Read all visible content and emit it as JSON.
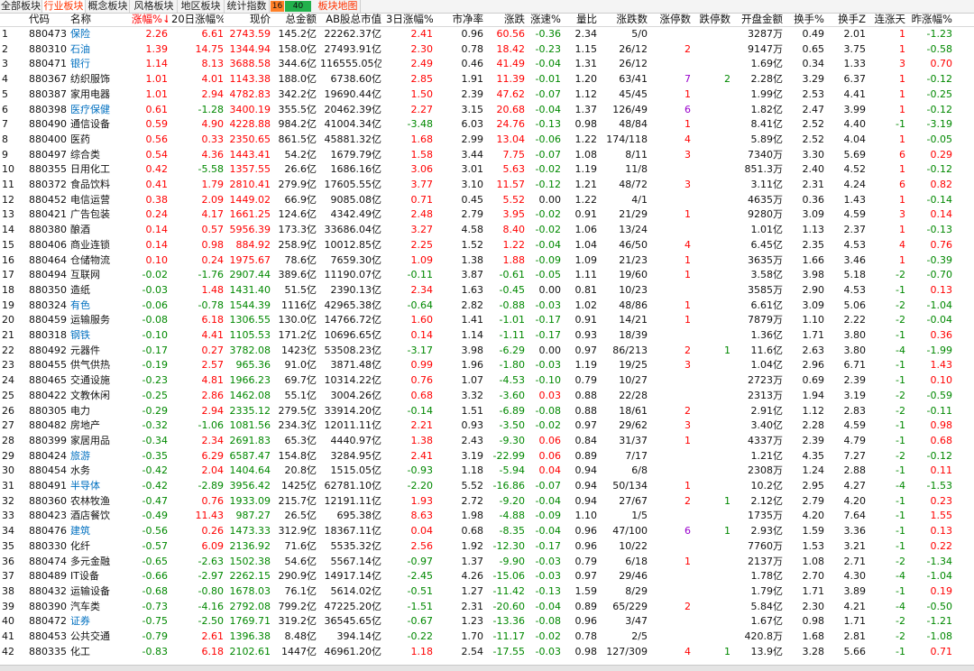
{
  "tabs": [
    {
      "label": "全部板块",
      "active": false
    },
    {
      "label": "行业板块",
      "active": true
    },
    {
      "label": "概念板块",
      "active": false
    },
    {
      "label": "风格板块",
      "active": false
    },
    {
      "label": "地区板块",
      "active": false
    },
    {
      "label": "统计指数",
      "active": false
    },
    {
      "label": "板块地图",
      "active": false
    }
  ],
  "counters": {
    "a": "16",
    "b": "40"
  },
  "colors": {
    "up": "#ff0000",
    "down": "#008800",
    "link": "#0070c0",
    "active_tab": "#ff3300",
    "counter_a": "#ff7f27",
    "counter_b": "#22b14c"
  },
  "headers": [
    "",
    "代码",
    "名称",
    "涨幅%↓",
    "20日涨幅%",
    "现价",
    "总金额",
    "AB股总市值",
    "3日涨幅%",
    "市净率",
    "涨跌",
    "涨速%",
    "量比",
    "涨跌数",
    "涨停数",
    "跌停数",
    "开盘金额",
    "换手%",
    "换手Z",
    "连涨天",
    "昨涨幅%"
  ],
  "rows": [
    [
      "1",
      "880473",
      "保险",
      "2.26",
      "6.61",
      "2743.59",
      "145.2亿",
      "22262.37亿",
      "2.41",
      "0.96",
      "60.56",
      "-0.36",
      "2.34",
      "5/0",
      "",
      "",
      "3287万",
      "0.49",
      "2.01",
      "1",
      "-1.23"
    ],
    [
      "2",
      "880310",
      "石油",
      "1.39",
      "14.75",
      "1344.94",
      "158.0亿",
      "27493.91亿",
      "2.30",
      "0.78",
      "18.42",
      "-0.23",
      "1.15",
      "26/12",
      "2",
      "",
      "9147万",
      "0.65",
      "3.75",
      "1",
      "-0.58"
    ],
    [
      "3",
      "880471",
      "银行",
      "1.14",
      "8.13",
      "3688.58",
      "344.6亿",
      "116555.05亿",
      "2.49",
      "0.46",
      "41.49",
      "-0.04",
      "1.31",
      "26/12",
      "",
      "",
      "1.69亿",
      "0.34",
      "1.33",
      "3",
      "0.70"
    ],
    [
      "4",
      "880367",
      "纺织服饰",
      "1.01",
      "4.01",
      "1143.38",
      "188.0亿",
      "6738.60亿",
      "2.85",
      "1.91",
      "11.39",
      "-0.01",
      "1.20",
      "63/41",
      "7",
      "2",
      "2.28亿",
      "3.29",
      "6.37",
      "1",
      "-0.12"
    ],
    [
      "5",
      "880387",
      "家用电器",
      "1.01",
      "2.94",
      "4782.83",
      "342.2亿",
      "19690.44亿",
      "1.50",
      "2.39",
      "47.62",
      "-0.07",
      "1.12",
      "45/45",
      "1",
      "",
      "1.99亿",
      "2.53",
      "4.41",
      "1",
      "-0.25"
    ],
    [
      "6",
      "880398",
      "医疗保健",
      "0.61",
      "-1.28",
      "3400.19",
      "355.5亿",
      "20462.39亿",
      "2.27",
      "3.15",
      "20.68",
      "-0.04",
      "1.37",
      "126/49",
      "6",
      "",
      "1.82亿",
      "2.47",
      "3.99",
      "1",
      "-0.12"
    ],
    [
      "7",
      "880490",
      "通信设备",
      "0.59",
      "4.90",
      "4228.88",
      "984.2亿",
      "41004.34亿",
      "-3.48",
      "6.03",
      "24.76",
      "-0.13",
      "0.98",
      "48/84",
      "1",
      "",
      "8.41亿",
      "2.52",
      "4.40",
      "-1",
      "-3.19"
    ],
    [
      "8",
      "880400",
      "医药",
      "0.56",
      "0.33",
      "2350.65",
      "861.5亿",
      "45881.32亿",
      "1.68",
      "2.99",
      "13.04",
      "-0.06",
      "1.22",
      "174/118",
      "4",
      "",
      "5.89亿",
      "2.52",
      "4.04",
      "1",
      "-0.05"
    ],
    [
      "9",
      "880497",
      "综合类",
      "0.54",
      "4.36",
      "1443.41",
      "54.2亿",
      "1679.79亿",
      "1.58",
      "3.44",
      "7.75",
      "-0.07",
      "1.08",
      "8/11",
      "3",
      "",
      "7340万",
      "3.30",
      "5.69",
      "6",
      "0.29"
    ],
    [
      "10",
      "880355",
      "日用化工",
      "0.42",
      "-5.58",
      "1357.55",
      "26.6亿",
      "1686.16亿",
      "3.06",
      "3.01",
      "5.63",
      "-0.02",
      "1.19",
      "11/8",
      "",
      "",
      "851.3万",
      "2.40",
      "4.52",
      "1",
      "-0.12"
    ],
    [
      "11",
      "880372",
      "食品饮料",
      "0.41",
      "1.79",
      "2810.41",
      "279.9亿",
      "17605.55亿",
      "3.77",
      "3.10",
      "11.57",
      "-0.12",
      "1.21",
      "48/72",
      "3",
      "",
      "3.11亿",
      "2.31",
      "4.24",
      "6",
      "0.82"
    ],
    [
      "12",
      "880452",
      "电信运营",
      "0.38",
      "2.09",
      "1449.02",
      "66.9亿",
      "9085.08亿",
      "0.71",
      "0.45",
      "5.52",
      "0.00",
      "1.22",
      "4/1",
      "",
      "",
      "4635万",
      "0.36",
      "1.43",
      "1",
      "-0.14"
    ],
    [
      "13",
      "880421",
      "广告包装",
      "0.24",
      "4.17",
      "1661.25",
      "124.6亿",
      "4342.49亿",
      "2.48",
      "2.79",
      "3.95",
      "-0.02",
      "0.91",
      "21/29",
      "1",
      "",
      "9280万",
      "3.09",
      "4.59",
      "3",
      "0.14"
    ],
    [
      "14",
      "880380",
      "酿酒",
      "0.14",
      "0.57",
      "5956.39",
      "173.3亿",
      "33686.04亿",
      "3.27",
      "4.58",
      "8.40",
      "-0.02",
      "1.06",
      "13/24",
      "",
      "",
      "1.01亿",
      "1.13",
      "2.37",
      "1",
      "-0.13"
    ],
    [
      "15",
      "880406",
      "商业连锁",
      "0.14",
      "0.98",
      "884.92",
      "258.9亿",
      "10012.85亿",
      "2.25",
      "1.52",
      "1.22",
      "-0.04",
      "1.04",
      "46/50",
      "4",
      "",
      "6.45亿",
      "2.35",
      "4.53",
      "4",
      "0.76"
    ],
    [
      "16",
      "880464",
      "仓储物流",
      "0.10",
      "0.24",
      "1975.67",
      "78.6亿",
      "7659.30亿",
      "1.09",
      "1.38",
      "1.88",
      "-0.09",
      "1.09",
      "21/23",
      "1",
      "",
      "3635万",
      "1.66",
      "3.46",
      "1",
      "-0.39"
    ],
    [
      "17",
      "880494",
      "互联网",
      "-0.02",
      "-1.76",
      "2907.44",
      "389.6亿",
      "11190.07亿",
      "-0.11",
      "3.87",
      "-0.61",
      "-0.05",
      "1.11",
      "19/60",
      "1",
      "",
      "3.58亿",
      "3.98",
      "5.18",
      "-2",
      "-0.70"
    ],
    [
      "18",
      "880350",
      "造纸",
      "-0.03",
      "1.48",
      "1431.40",
      "51.5亿",
      "2390.13亿",
      "2.34",
      "1.63",
      "-0.45",
      "0.00",
      "0.81",
      "10/23",
      "",
      "",
      "3585万",
      "2.90",
      "4.53",
      "-1",
      "0.13"
    ],
    [
      "19",
      "880324",
      "有色",
      "-0.06",
      "-0.78",
      "1544.39",
      "1116亿",
      "42965.38亿",
      "-0.64",
      "2.82",
      "-0.88",
      "-0.03",
      "1.02",
      "48/86",
      "1",
      "",
      "6.61亿",
      "3.09",
      "5.06",
      "-2",
      "-1.04"
    ],
    [
      "20",
      "880459",
      "运输服务",
      "-0.08",
      "6.18",
      "1306.55",
      "130.0亿",
      "14766.72亿",
      "1.60",
      "1.41",
      "-1.01",
      "-0.17",
      "0.91",
      "14/21",
      "1",
      "",
      "7879万",
      "1.10",
      "2.22",
      "-2",
      "-0.04"
    ],
    [
      "21",
      "880318",
      "钢铁",
      "-0.10",
      "4.41",
      "1105.53",
      "171.2亿",
      "10696.65亿",
      "0.14",
      "1.14",
      "-1.11",
      "-0.17",
      "0.93",
      "18/39",
      "",
      "",
      "1.36亿",
      "1.71",
      "3.80",
      "-1",
      "0.36"
    ],
    [
      "22",
      "880492",
      "元器件",
      "-0.17",
      "0.27",
      "3782.08",
      "1423亿",
      "53508.23亿",
      "-3.17",
      "3.98",
      "-6.29",
      "0.00",
      "0.97",
      "86/213",
      "2",
      "1",
      "11.6亿",
      "2.63",
      "3.80",
      "-4",
      "-1.99"
    ],
    [
      "23",
      "880455",
      "供气供热",
      "-0.19",
      "2.57",
      "965.36",
      "91.0亿",
      "3871.48亿",
      "0.99",
      "1.96",
      "-1.80",
      "-0.03",
      "1.19",
      "19/25",
      "3",
      "",
      "1.04亿",
      "2.96",
      "6.71",
      "-1",
      "1.43"
    ],
    [
      "24",
      "880465",
      "交通设施",
      "-0.23",
      "4.81",
      "1966.23",
      "69.7亿",
      "10314.22亿",
      "0.76",
      "1.07",
      "-4.53",
      "-0.10",
      "0.79",
      "10/27",
      "",
      "",
      "2723万",
      "0.69",
      "2.39",
      "-1",
      "0.10"
    ],
    [
      "25",
      "880422",
      "文教休闲",
      "-0.25",
      "2.86",
      "1462.08",
      "55.1亿",
      "3004.26亿",
      "0.68",
      "3.32",
      "-3.60",
      "0.03",
      "0.88",
      "22/28",
      "",
      "",
      "2313万",
      "1.94",
      "3.19",
      "-2",
      "-0.59"
    ],
    [
      "26",
      "880305",
      "电力",
      "-0.29",
      "2.94",
      "2335.12",
      "279.5亿",
      "33914.20亿",
      "-0.14",
      "1.51",
      "-6.89",
      "-0.08",
      "0.88",
      "18/61",
      "2",
      "",
      "2.91亿",
      "1.12",
      "2.83",
      "-2",
      "-0.11"
    ],
    [
      "27",
      "880482",
      "房地产",
      "-0.32",
      "-1.06",
      "1081.56",
      "234.3亿",
      "12011.11亿",
      "2.21",
      "0.93",
      "-3.50",
      "-0.02",
      "0.97",
      "29/62",
      "3",
      "",
      "3.40亿",
      "2.28",
      "4.59",
      "-1",
      "0.98"
    ],
    [
      "28",
      "880399",
      "家居用品",
      "-0.34",
      "2.34",
      "2691.83",
      "65.3亿",
      "4440.97亿",
      "1.38",
      "2.43",
      "-9.30",
      "0.06",
      "0.84",
      "31/37",
      "1",
      "",
      "4337万",
      "2.39",
      "4.79",
      "-1",
      "0.68"
    ],
    [
      "29",
      "880424",
      "旅游",
      "-0.35",
      "6.29",
      "6587.47",
      "154.8亿",
      "3284.95亿",
      "2.41",
      "3.19",
      "-22.99",
      "0.06",
      "0.89",
      "7/17",
      "",
      "",
      "1.21亿",
      "4.35",
      "7.27",
      "-2",
      "-0.12"
    ],
    [
      "30",
      "880454",
      "水务",
      "-0.42",
      "2.04",
      "1404.64",
      "20.8亿",
      "1515.05亿",
      "-0.93",
      "1.18",
      "-5.94",
      "0.04",
      "0.94",
      "6/8",
      "",
      "",
      "2308万",
      "1.24",
      "2.88",
      "-1",
      "0.11"
    ],
    [
      "31",
      "880491",
      "半导体",
      "-0.42",
      "-2.89",
      "3956.42",
      "1425亿",
      "62781.10亿",
      "-2.20",
      "5.52",
      "-16.86",
      "-0.07",
      "0.94",
      "50/134",
      "1",
      "",
      "10.2亿",
      "2.95",
      "4.27",
      "-4",
      "-1.53"
    ],
    [
      "32",
      "880360",
      "农林牧渔",
      "-0.47",
      "0.76",
      "1933.09",
      "215.7亿",
      "12191.11亿",
      "1.93",
      "2.72",
      "-9.20",
      "-0.04",
      "0.94",
      "27/67",
      "2",
      "1",
      "2.12亿",
      "2.79",
      "4.20",
      "-1",
      "0.23"
    ],
    [
      "33",
      "880423",
      "酒店餐饮",
      "-0.49",
      "11.43",
      "987.27",
      "26.5亿",
      "695.38亿",
      "8.63",
      "1.98",
      "-4.88",
      "-0.09",
      "1.10",
      "1/5",
      "",
      "",
      "1735万",
      "4.20",
      "7.64",
      "-1",
      "1.55"
    ],
    [
      "34",
      "880476",
      "建筑",
      "-0.56",
      "0.26",
      "1473.33",
      "312.9亿",
      "18367.11亿",
      "0.04",
      "0.68",
      "-8.35",
      "-0.04",
      "0.96",
      "47/100",
      "6",
      "1",
      "2.93亿",
      "1.59",
      "3.36",
      "-1",
      "0.13"
    ],
    [
      "35",
      "880330",
      "化纤",
      "-0.57",
      "6.09",
      "2136.92",
      "71.6亿",
      "5535.32亿",
      "2.56",
      "1.92",
      "-12.30",
      "-0.17",
      "0.96",
      "10/22",
      "",
      "",
      "7760万",
      "1.53",
      "3.21",
      "-1",
      "0.22"
    ],
    [
      "36",
      "880474",
      "多元金融",
      "-0.65",
      "-2.63",
      "1502.38",
      "54.6亿",
      "5567.14亿",
      "-0.97",
      "1.37",
      "-9.90",
      "-0.03",
      "0.79",
      "6/18",
      "1",
      "",
      "2137万",
      "1.08",
      "2.71",
      "-2",
      "-1.34"
    ],
    [
      "37",
      "880489",
      "IT设备",
      "-0.66",
      "-2.97",
      "2262.15",
      "290.9亿",
      "14917.14亿",
      "-2.45",
      "4.26",
      "-15.06",
      "-0.03",
      "0.97",
      "29/46",
      "",
      "",
      "1.78亿",
      "2.70",
      "4.30",
      "-4",
      "-1.04"
    ],
    [
      "38",
      "880432",
      "运输设备",
      "-0.68",
      "-0.80",
      "1678.03",
      "76.1亿",
      "5614.02亿",
      "-0.51",
      "1.27",
      "-11.42",
      "-0.13",
      "1.59",
      "8/29",
      "",
      "",
      "1.79亿",
      "1.71",
      "3.89",
      "-1",
      "0.19"
    ],
    [
      "39",
      "880390",
      "汽车类",
      "-0.73",
      "-4.16",
      "2792.08",
      "799.2亿",
      "47225.20亿",
      "-1.51",
      "2.31",
      "-20.60",
      "-0.04",
      "0.89",
      "65/229",
      "2",
      "",
      "5.84亿",
      "2.30",
      "4.21",
      "-4",
      "-0.50"
    ],
    [
      "40",
      "880472",
      "证券",
      "-0.75",
      "-2.50",
      "1769.71",
      "319.2亿",
      "36545.65亿",
      "-0.67",
      "1.23",
      "-13.36",
      "-0.08",
      "0.96",
      "3/47",
      "",
      "",
      "1.67亿",
      "0.98",
      "1.71",
      "-2",
      "-1.21"
    ],
    [
      "41",
      "880453",
      "公共交通",
      "-0.79",
      "2.61",
      "1396.38",
      "8.48亿",
      "394.14亿",
      "-0.22",
      "1.70",
      "-11.17",
      "-0.02",
      "0.78",
      "2/5",
      "",
      "",
      "420.8万",
      "1.68",
      "2.81",
      "-2",
      "-1.08"
    ],
    [
      "42",
      "880335",
      "化工",
      "-0.83",
      "6.18",
      "2102.61",
      "1447亿",
      "46961.20亿",
      "1.18",
      "2.54",
      "-17.55",
      "-0.03",
      "0.98",
      "127/309",
      "4",
      "1",
      "13.9亿",
      "3.28",
      "5.66",
      "-1",
      "0.71"
    ]
  ]
}
